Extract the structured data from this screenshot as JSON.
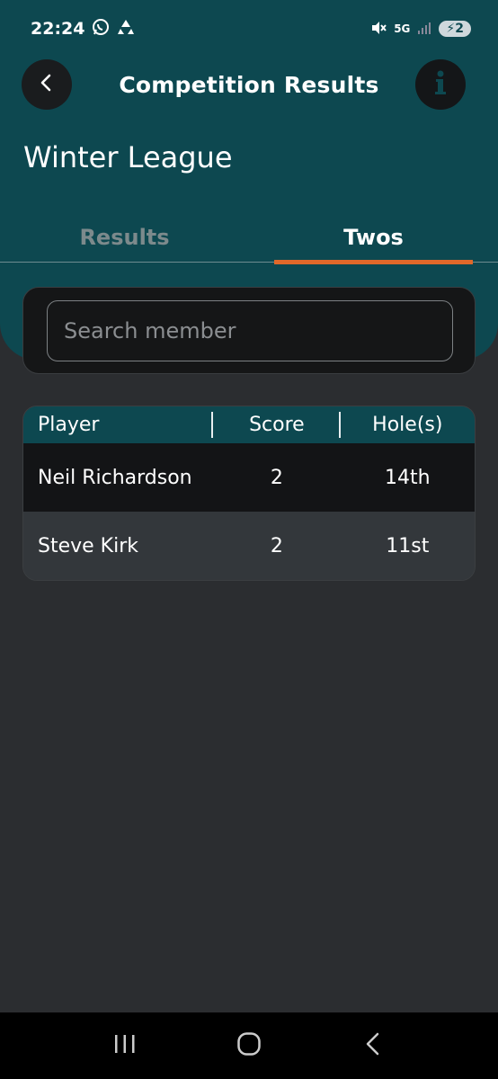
{
  "status_bar": {
    "time": "22:24",
    "network": "5G",
    "battery": "2"
  },
  "header": {
    "title": "Competition Results"
  },
  "competition": {
    "name": "Winter League"
  },
  "tabs": [
    {
      "label": "Results",
      "active": false
    },
    {
      "label": "Twos",
      "active": true
    }
  ],
  "search": {
    "placeholder": "Search member",
    "value": ""
  },
  "table": {
    "columns": [
      "Player",
      "Score",
      "Hole(s)"
    ],
    "rows": [
      {
        "player": "Neil Richardson",
        "score": "2",
        "holes": "14th"
      },
      {
        "player": "Steve Kirk",
        "score": "2",
        "holes": "11st"
      }
    ]
  },
  "colors": {
    "accent": "#e0682a",
    "teal": "#0d4850",
    "background": "#2b2d30"
  },
  "icons": {
    "back": "chevron-left-icon",
    "info": "info-icon",
    "whatsapp": "whatsapp-icon",
    "recycle": "recycle-icon",
    "mute": "mute-icon",
    "signal": "signal-icon",
    "nav_recents": "recents-icon",
    "nav_home": "home-icon",
    "nav_back": "back-icon"
  }
}
